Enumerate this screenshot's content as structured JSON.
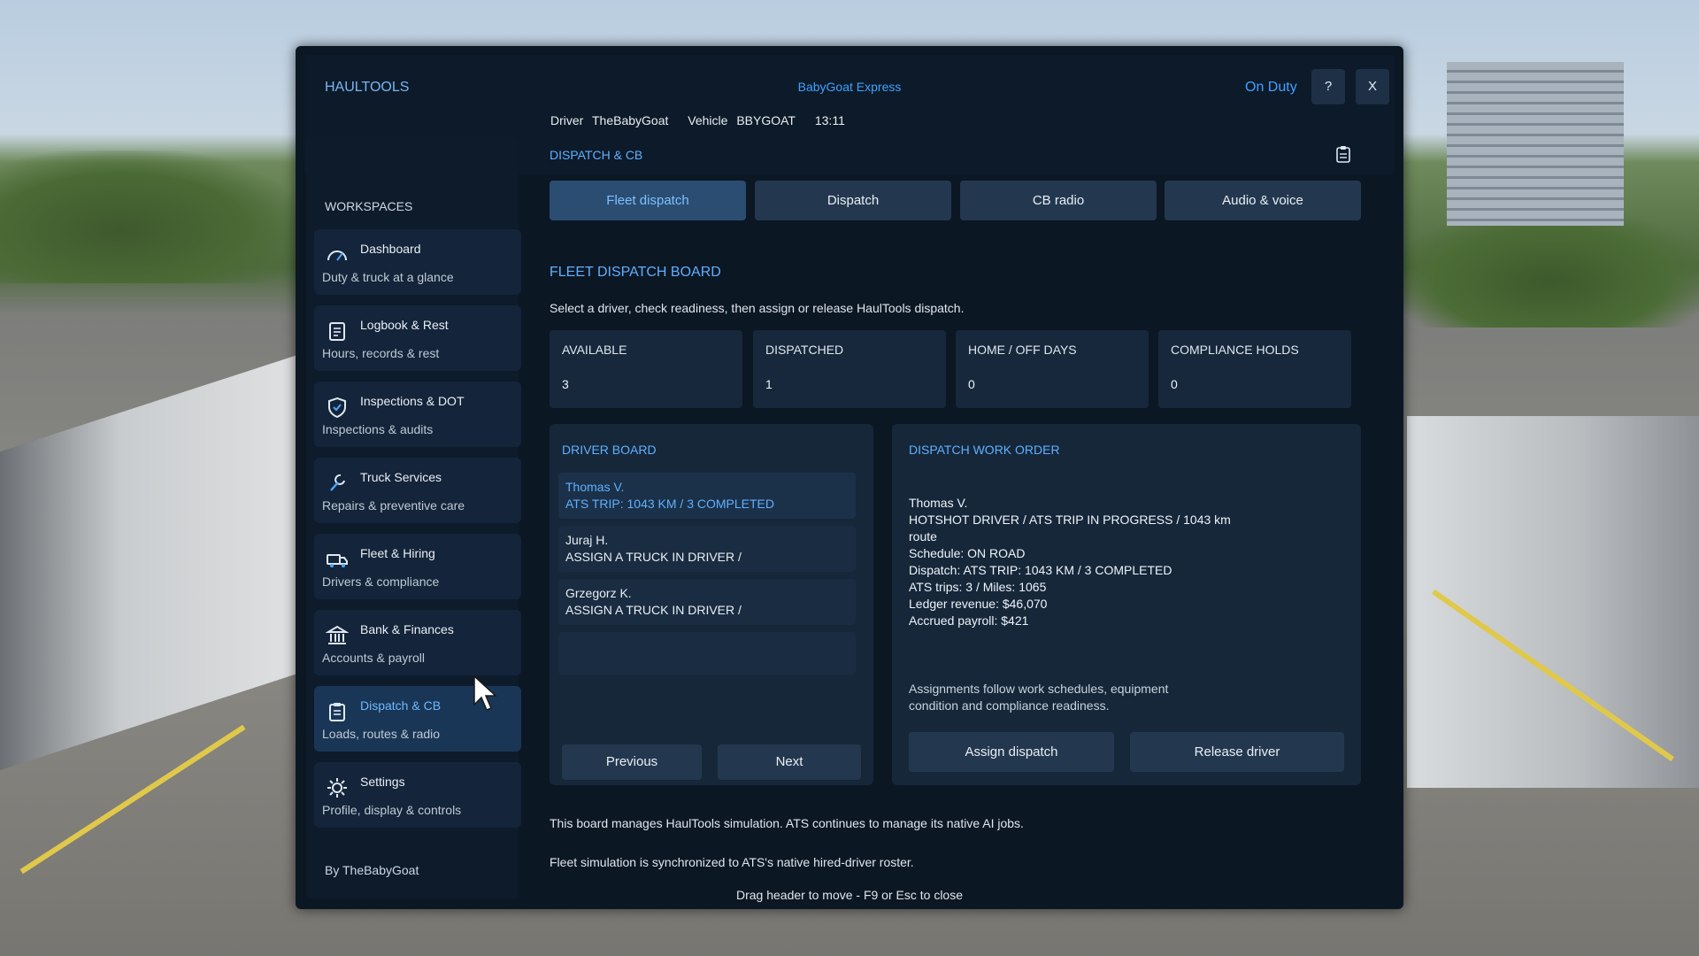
{
  "app": {
    "brand": "HAULTOOLS",
    "company": "BabyGoat Express",
    "status": "On Duty",
    "help_label": "?",
    "close_label": "X"
  },
  "driver_info": {
    "driver_label": "Driver",
    "driver_name": "TheBabyGoat",
    "vehicle_label": "Vehicle",
    "vehicle_id": "BBYGOAT",
    "time": "13:11"
  },
  "sidebar": {
    "title": "WORKSPACES",
    "items": [
      {
        "label": "Dashboard",
        "sub": "Duty & truck at a glance",
        "icon": "speedometer-icon"
      },
      {
        "label": "Logbook & Rest",
        "sub": "Hours, records & rest",
        "icon": "logbook-icon"
      },
      {
        "label": "Inspections & DOT",
        "sub": "Inspections & audits",
        "icon": "shield-check-icon"
      },
      {
        "label": "Truck Services",
        "sub": "Repairs & preventive care",
        "icon": "wrench-icon"
      },
      {
        "label": "Fleet & Hiring",
        "sub": "Drivers & compliance",
        "icon": "truck-icon"
      },
      {
        "label": "Bank & Finances",
        "sub": "Accounts & payroll",
        "icon": "bank-icon"
      },
      {
        "label": "Dispatch & CB",
        "sub": "Loads, routes & radio",
        "icon": "clipboard-icon"
      },
      {
        "label": "Settings",
        "sub": "Profile, display & controls",
        "icon": "gear-icon"
      }
    ],
    "active_index": 6,
    "byline": "By TheBabyGoat"
  },
  "main": {
    "title": "DISPATCH & CB",
    "tabs": [
      "Fleet dispatch",
      "Dispatch",
      "CB radio",
      "Audio & voice"
    ],
    "active_tab": 0,
    "section_title": "FLEET DISPATCH BOARD",
    "section_desc": "Select a driver, check readiness, then assign or release HaulTools dispatch.",
    "stats": [
      {
        "label": "AVAILABLE",
        "value": "3"
      },
      {
        "label": "DISPATCHED",
        "value": "1"
      },
      {
        "label": "HOME / OFF DAYS",
        "value": "0"
      },
      {
        "label": "COMPLIANCE HOLDS",
        "value": "0"
      }
    ]
  },
  "driver_board": {
    "title": "DRIVER BOARD",
    "drivers": [
      {
        "name": "Thomas V.",
        "status": "ATS TRIP: 1043 KM / 3 COMPLETED"
      },
      {
        "name": "Juraj H.",
        "status": "ASSIGN A TRUCK IN DRIVER /"
      },
      {
        "name": "Grzegorz K.",
        "status": "ASSIGN A TRUCK IN DRIVER /"
      }
    ],
    "previous_label": "Previous",
    "next_label": "Next"
  },
  "work_order": {
    "title": "DISPATCH WORK ORDER",
    "name": "Thomas V.",
    "role_line1": "HOTSHOT DRIVER / ATS TRIP IN PROGRESS / 1043 km",
    "role_line2": "route",
    "schedule": "Schedule: ON ROAD",
    "dispatch": "Dispatch: ATS TRIP: 1043 KM / 3 COMPLETED",
    "trips": "ATS trips: 3 / Miles: 1065",
    "revenue": "Ledger revenue: $46,070",
    "payroll": "Accrued payroll: $421",
    "note_line1": "Assignments follow work schedules, equipment",
    "note_line2": "condition and compliance readiness.",
    "assign_label": "Assign dispatch",
    "release_label": "Release driver"
  },
  "footer": {
    "line1": "This board manages HaulTools simulation. ATS continues to manage its native AI jobs.",
    "line2": "Fleet simulation is synchronized to ATS's native hired-driver roster.",
    "hint": "Drag header to move - F9 or Esc to close"
  },
  "colors": {
    "accent": "#3ea2ff",
    "panel_bg": "#0c1724",
    "card_bg": "#16273a",
    "active_nav": "#1a3656"
  }
}
